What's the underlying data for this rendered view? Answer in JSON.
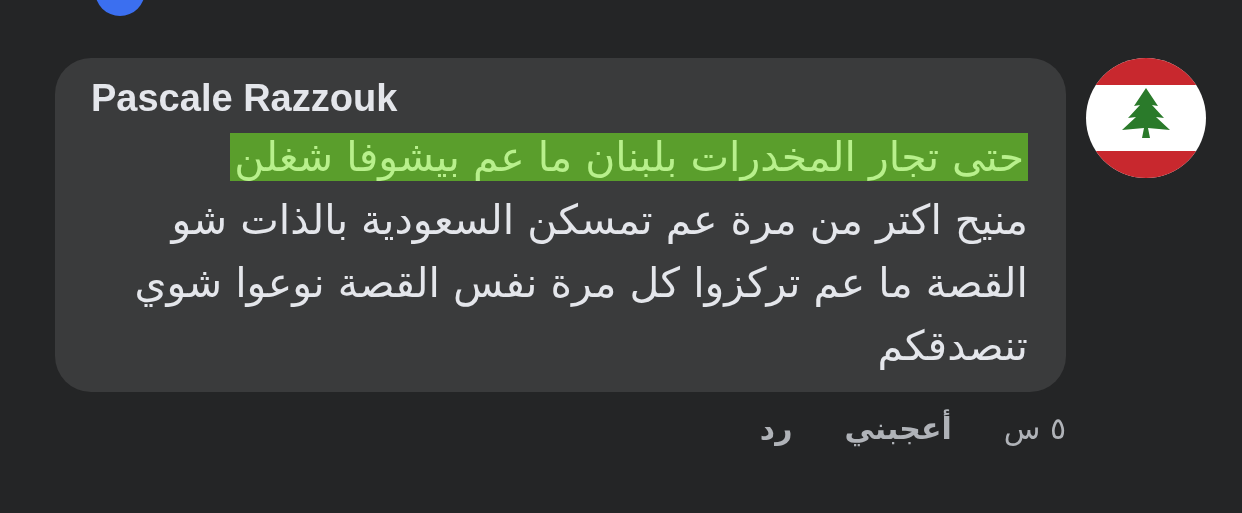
{
  "comment": {
    "author": "Pascale Razzouk",
    "lines": [
      {
        "text": "حتى تجار المخدرات بلبنان ما عم بيشوفا شغلن",
        "highlighted": true
      },
      {
        "text": "منيح اكتر من مرة عم تمسكن السعودية بالذات شو",
        "highlighted": false
      },
      {
        "text": "القصة ما عم تركزوا كل مرة نفس القصة نوعوا شوي",
        "highlighted": false
      },
      {
        "text": "تنصدقكم",
        "highlighted": false
      }
    ],
    "time": "٥ س",
    "actions": [
      "أعجبني",
      "رد"
    ]
  }
}
